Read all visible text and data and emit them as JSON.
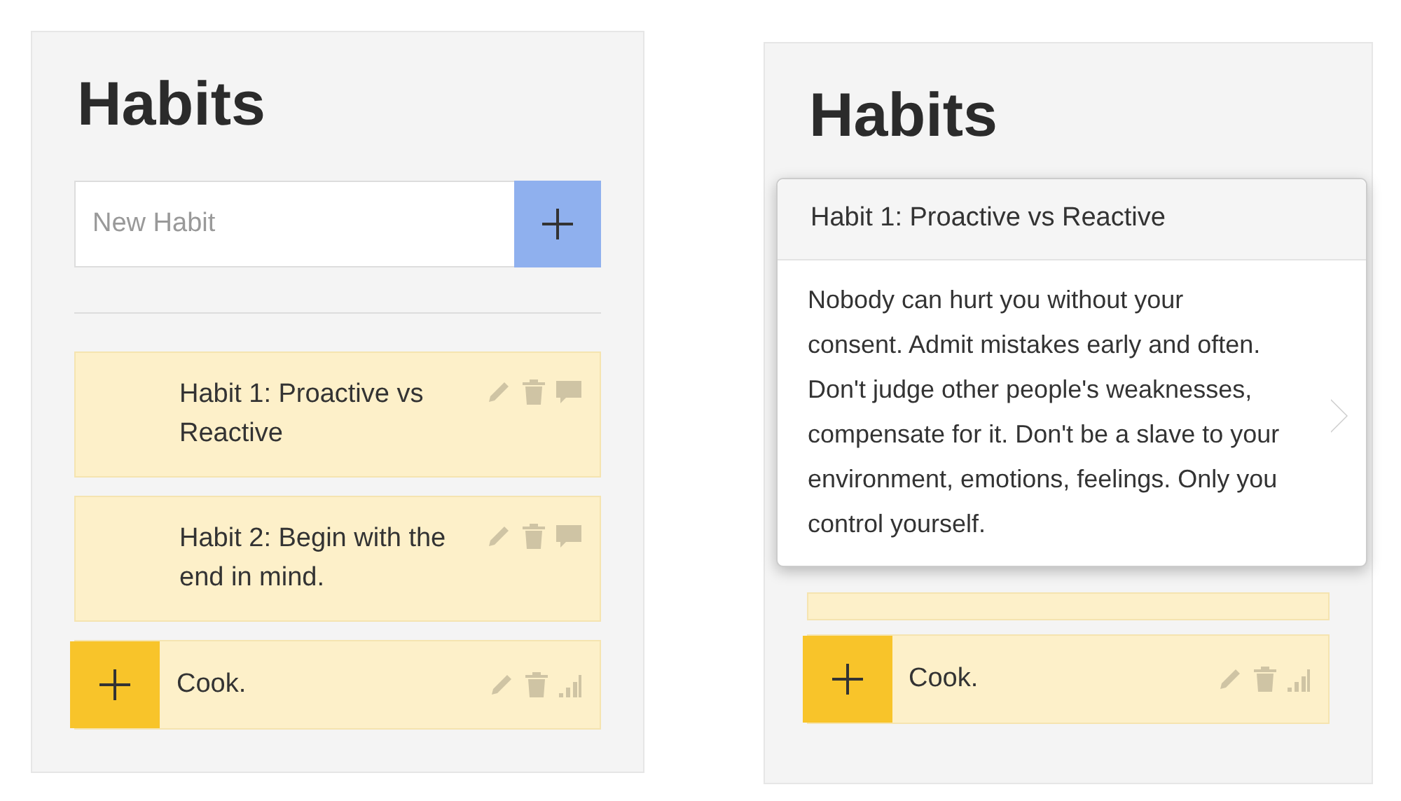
{
  "panels": [
    {
      "title": "Habits",
      "new_habit": {
        "placeholder": "New Habit"
      },
      "habits": [
        {
          "kind": "note",
          "label": "Habit 1: Proactive vs Reactive"
        },
        {
          "kind": "note",
          "label": "Habit 2: Begin with the end in mind."
        },
        {
          "kind": "counter",
          "label": "Cook."
        }
      ]
    },
    {
      "title": "Habits",
      "popover": {
        "title": "Habit 1: Proactive vs Reactive",
        "body": "Nobody can hurt you without your consent. Admit mistakes early and often. Don't judge other people's weaknesses, compensate for it. Don't be a slave to your environment, emotions, feelings. Only you control yourself."
      },
      "habits": [
        {
          "kind": "counter",
          "label": "Cook."
        }
      ]
    }
  ]
}
